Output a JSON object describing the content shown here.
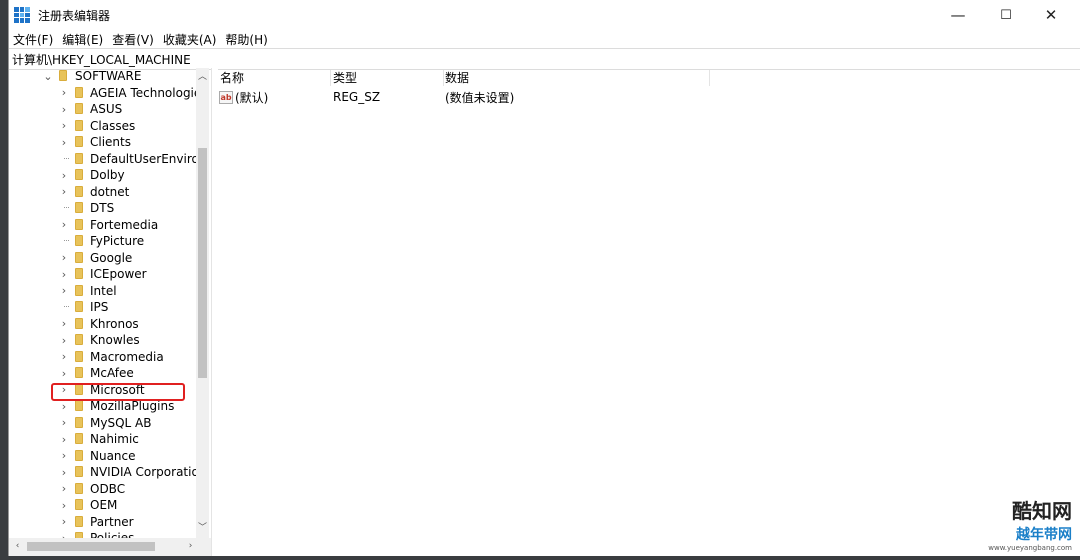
{
  "window": {
    "title": "注册表编辑器",
    "controls": {
      "minimize": "—",
      "maximize": "☐",
      "close": "✕"
    }
  },
  "menu": [
    "文件(F)",
    "编辑(E)",
    "查看(V)",
    "收藏夹(A)",
    "帮助(H)"
  ],
  "address": "计算机\\HKEY_LOCAL_MACHINE",
  "tree": {
    "parent": "SOFTWARE",
    "items": [
      {
        "label": "AGEIA Technologie",
        "expandable": true
      },
      {
        "label": "ASUS",
        "expandable": true
      },
      {
        "label": "Classes",
        "expandable": true
      },
      {
        "label": "Clients",
        "expandable": true
      },
      {
        "label": "DefaultUserEnviron",
        "expandable": false
      },
      {
        "label": "Dolby",
        "expandable": true
      },
      {
        "label": "dotnet",
        "expandable": true
      },
      {
        "label": "DTS",
        "expandable": false
      },
      {
        "label": "Fortemedia",
        "expandable": true
      },
      {
        "label": "FyPicture",
        "expandable": false
      },
      {
        "label": "Google",
        "expandable": true
      },
      {
        "label": "ICEpower",
        "expandable": true
      },
      {
        "label": "Intel",
        "expandable": true
      },
      {
        "label": "IPS",
        "expandable": false
      },
      {
        "label": "Khronos",
        "expandable": true
      },
      {
        "label": "Knowles",
        "expandable": true
      },
      {
        "label": "Macromedia",
        "expandable": true
      },
      {
        "label": "McAfee",
        "expandable": true
      },
      {
        "label": "Microsoft",
        "expandable": true,
        "highlighted": true
      },
      {
        "label": "MozillaPlugins",
        "expandable": true
      },
      {
        "label": "MySQL AB",
        "expandable": true
      },
      {
        "label": "Nahimic",
        "expandable": true
      },
      {
        "label": "Nuance",
        "expandable": true
      },
      {
        "label": "NVIDIA Corporatio",
        "expandable": true
      },
      {
        "label": "ODBC",
        "expandable": true
      },
      {
        "label": "OEM",
        "expandable": true
      },
      {
        "label": "Partner",
        "expandable": true
      },
      {
        "label": "Policies",
        "expandable": true
      }
    ]
  },
  "list": {
    "columns": [
      "名称",
      "类型",
      "数据"
    ],
    "rows": [
      {
        "name": "(默认)",
        "type": "REG_SZ",
        "data": "(数值未设置)"
      }
    ]
  },
  "watermark": {
    "line1": "酷知网",
    "line2": "越年带网",
    "url": "www.yueyangbang.com"
  },
  "colors": {
    "highlight_box": "#e02020",
    "folder": "#e8c35a"
  }
}
